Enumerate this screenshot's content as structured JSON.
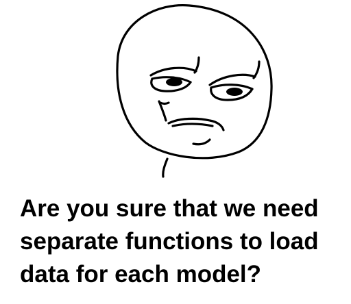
{
  "image": {
    "icon": "are-you-sure-rage-face",
    "stroke_color": "#000000",
    "background_color": "#ffffff"
  },
  "caption": {
    "lines": [
      "Are you sure that we need",
      "separate functions to load",
      "data for each model?"
    ]
  }
}
